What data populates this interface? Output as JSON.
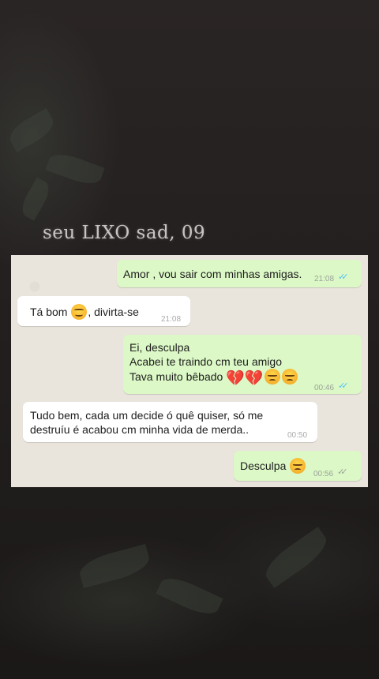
{
  "caption": "seu LIXO sad, 09",
  "messages": [
    {
      "direction": "out",
      "text": "Amor , vou sair com minhas amigas.",
      "time": "21:08",
      "status": "read"
    },
    {
      "direction": "in",
      "text_before": "Tá bom",
      "emoji": "smiling-face-icon",
      "text_after": ", divirta-se",
      "time": "21:08"
    },
    {
      "direction": "out",
      "line1": "Ei, desculpa",
      "line2": "Acabei te traindo cm teu amigo",
      "line3": "Tava muito bêbado",
      "emojis": [
        "broken-heart-icon",
        "broken-heart-icon",
        "disappointed-face-icon",
        "disappointed-face-icon"
      ],
      "time": "00:46",
      "status": "read"
    },
    {
      "direction": "in",
      "line1": "Tudo bem, cada um decide ó quê quiser, só me",
      "line2": "destruíu é acabou cm minha vida de merda..",
      "time": "00:50"
    },
    {
      "direction": "out",
      "text": "Desculpa",
      "emoji": "disappointed-face-icon",
      "time": "00:56",
      "status": "delivered"
    }
  ],
  "colors": {
    "outgoing": "#dcf8c6",
    "incoming": "#ffffff",
    "read_ticks": "#4fc3f7",
    "chat_bg": "#e9e4dc"
  },
  "glyphs": {
    "ticks": "✓✓",
    "broken_heart": "💔"
  }
}
